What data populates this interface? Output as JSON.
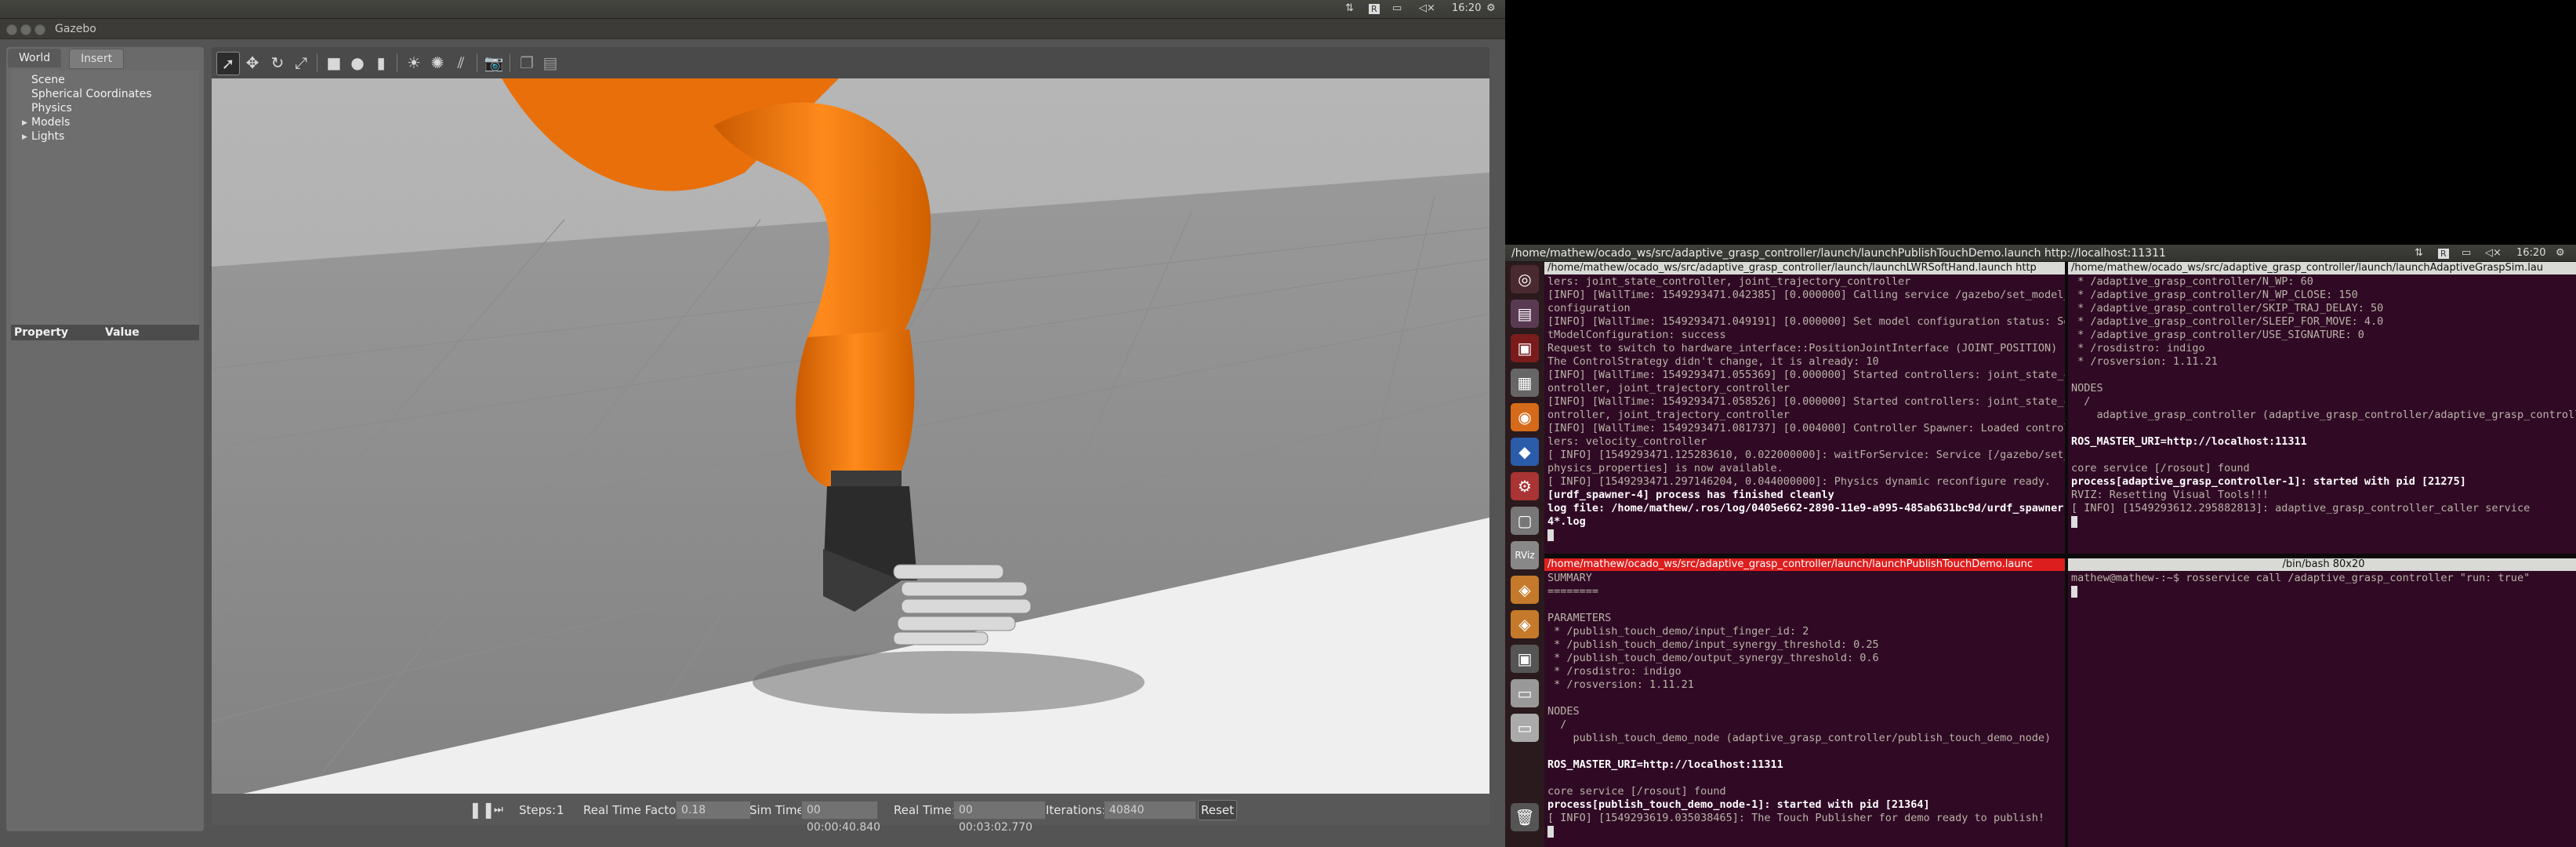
{
  "gazebo": {
    "window_title": "Gazebo",
    "clock": "16:20",
    "tabs": [
      "World",
      "Insert"
    ],
    "tree": [
      "Scene",
      "Spherical Coordinates",
      "Physics",
      "Models",
      "Lights"
    ],
    "property_headers": [
      "Property",
      "Value"
    ],
    "status": {
      "steps_label": "Steps:",
      "steps_value": "1",
      "rtf_label": "Real Time Factor:",
      "rtf_value": "0.18",
      "sim_time_label": "Sim Time:",
      "sim_time_value": "00 00:00:40.840",
      "real_time_label": "Real Time:",
      "real_time_value": "00 00:03:02.770",
      "iterations_label": "Iterations:",
      "iterations_value": "40840",
      "reset_label": "Reset"
    }
  },
  "desktop": {
    "window_title": "/home/mathew/ocado_ws/src/adaptive_grasp_controller/launch/launchPublishTouchDemo.launch http://localhost:11311",
    "clock": "16:20"
  },
  "terminals": {
    "top_left": {
      "title": "/home/mathew/ocado_ws/src/adaptive_grasp_controller/launch/launchLWRSoftHand.launch http",
      "lines": [
        {
          "t": "lers: joint_state_controller, joint_trajectory_controller"
        },
        {
          "t": "[INFO] [WallTime: 1549293471.042385] [0.000000] Calling service /gazebo/set_model_"
        },
        {
          "t": "configuration"
        },
        {
          "t": "[INFO] [WallTime: 1549293471.049191] [0.000000] Set model configuration status: Se"
        },
        {
          "t": "tModelConfiguration: success"
        },
        {
          "t": "Request to switch to hardware_interface::PositionJointInterface (JOINT_POSITION)"
        },
        {
          "t": "The ControlStrategy didn't change, it is already: 10"
        },
        {
          "t": "[INFO] [WallTime: 1549293471.055369] [0.000000] Started controllers: joint_state_c"
        },
        {
          "t": "ontroller, joint_trajectory_controller"
        },
        {
          "t": "[INFO] [WallTime: 1549293471.058526] [0.000000] Started controllers: joint_state_c"
        },
        {
          "t": "ontroller, joint_trajectory_controller"
        },
        {
          "t": "[INFO] [WallTime: 1549293471.081737] [0.004000] Controller Spawner: Loaded controlr"
        },
        {
          "t": "lers: velocity_controller"
        },
        {
          "t": "[ INFO] [1549293471.125283610, 0.022000000]: waitForService: Service [/gazebo/set_"
        },
        {
          "t": "physics_properties] is now available."
        },
        {
          "t": "[ INFO] [1549293471.297146204, 0.044000000]: Physics dynamic reconfigure ready."
        },
        {
          "t": "[urdf_spawner-4] process has finished cleanly",
          "bold": true
        },
        {
          "t": "log file: /home/mathew/.ros/log/0405e662-2890-11e9-a995-485ab631bc9d/urdf_spawner-",
          "bold": true
        },
        {
          "t": "4*.log",
          "bold": true
        }
      ]
    },
    "top_right": {
      "title": "/home/mathew/ocado_ws/src/adaptive_grasp_controller/launch/launchAdaptiveGraspSim.lau",
      "lines": [
        {
          "t": " * /adaptive_grasp_controller/N_WP: 60"
        },
        {
          "t": " * /adaptive_grasp_controller/N_WP_CLOSE: 150"
        },
        {
          "t": " * /adaptive_grasp_controller/SKIP_TRAJ_DELAY: 50"
        },
        {
          "t": " * /adaptive_grasp_controller/SLEEP_FOR_MOVE: 4.0"
        },
        {
          "t": " * /adaptive_grasp_controller/USE_SIGNATURE: 0"
        },
        {
          "t": " * /rosdistro: indigo"
        },
        {
          "t": " * /rosversion: 1.11.21"
        },
        {
          "t": ""
        },
        {
          "t": "NODES"
        },
        {
          "t": "  /"
        },
        {
          "t": "    adaptive_grasp_controller (adaptive_grasp_controller/adaptive_grasp_controll"
        },
        {
          "t": ""
        },
        {
          "t": "ROS_MASTER_URI=http://localhost:11311",
          "bold": true
        },
        {
          "t": ""
        },
        {
          "t": "core service [/rosout] found"
        },
        {
          "t": "process[adaptive_grasp_controller-1]: started with pid [21275]",
          "bold": true
        },
        {
          "t": "RVIZ: Resetting Visual Tools!!!"
        },
        {
          "t": "[ INFO] [1549293612.295882813]: adaptive_grasp_controller_caller service"
        }
      ]
    },
    "bottom_left": {
      "title": "/home/mathew/ocado_ws/src/adaptive_grasp_controller/launch/launchPublishTouchDemo.launc",
      "lines": [
        {
          "t": "SUMMARY"
        },
        {
          "t": "========"
        },
        {
          "t": ""
        },
        {
          "t": "PARAMETERS"
        },
        {
          "t": " * /publish_touch_demo/input_finger_id: 2"
        },
        {
          "t": " * /publish_touch_demo/input_synergy_threshold: 0.25"
        },
        {
          "t": " * /publish_touch_demo/output_synergy_threshold: 0.6"
        },
        {
          "t": " * /rosdistro: indigo"
        },
        {
          "t": " * /rosversion: 1.11.21"
        },
        {
          "t": ""
        },
        {
          "t": "NODES"
        },
        {
          "t": "  /"
        },
        {
          "t": "    publish_touch_demo_node (adaptive_grasp_controller/publish_touch_demo_node)"
        },
        {
          "t": ""
        },
        {
          "t": "ROS_MASTER_URI=http://localhost:11311",
          "bold": true
        },
        {
          "t": ""
        },
        {
          "t": "core service [/rosout] found"
        },
        {
          "t": "process[publish_touch_demo_node-1]: started with pid [21364]",
          "bold": true
        },
        {
          "t": "[ INFO] [1549293619.035038465]: The Touch Publisher for demo ready to publish!"
        }
      ]
    },
    "bottom_right": {
      "title": "/bin/bash 80x20",
      "lines": [
        {
          "t": "mathew@mathew-:~$ rosservice call /adaptive_grasp_controller \"run: true\""
        }
      ]
    }
  }
}
